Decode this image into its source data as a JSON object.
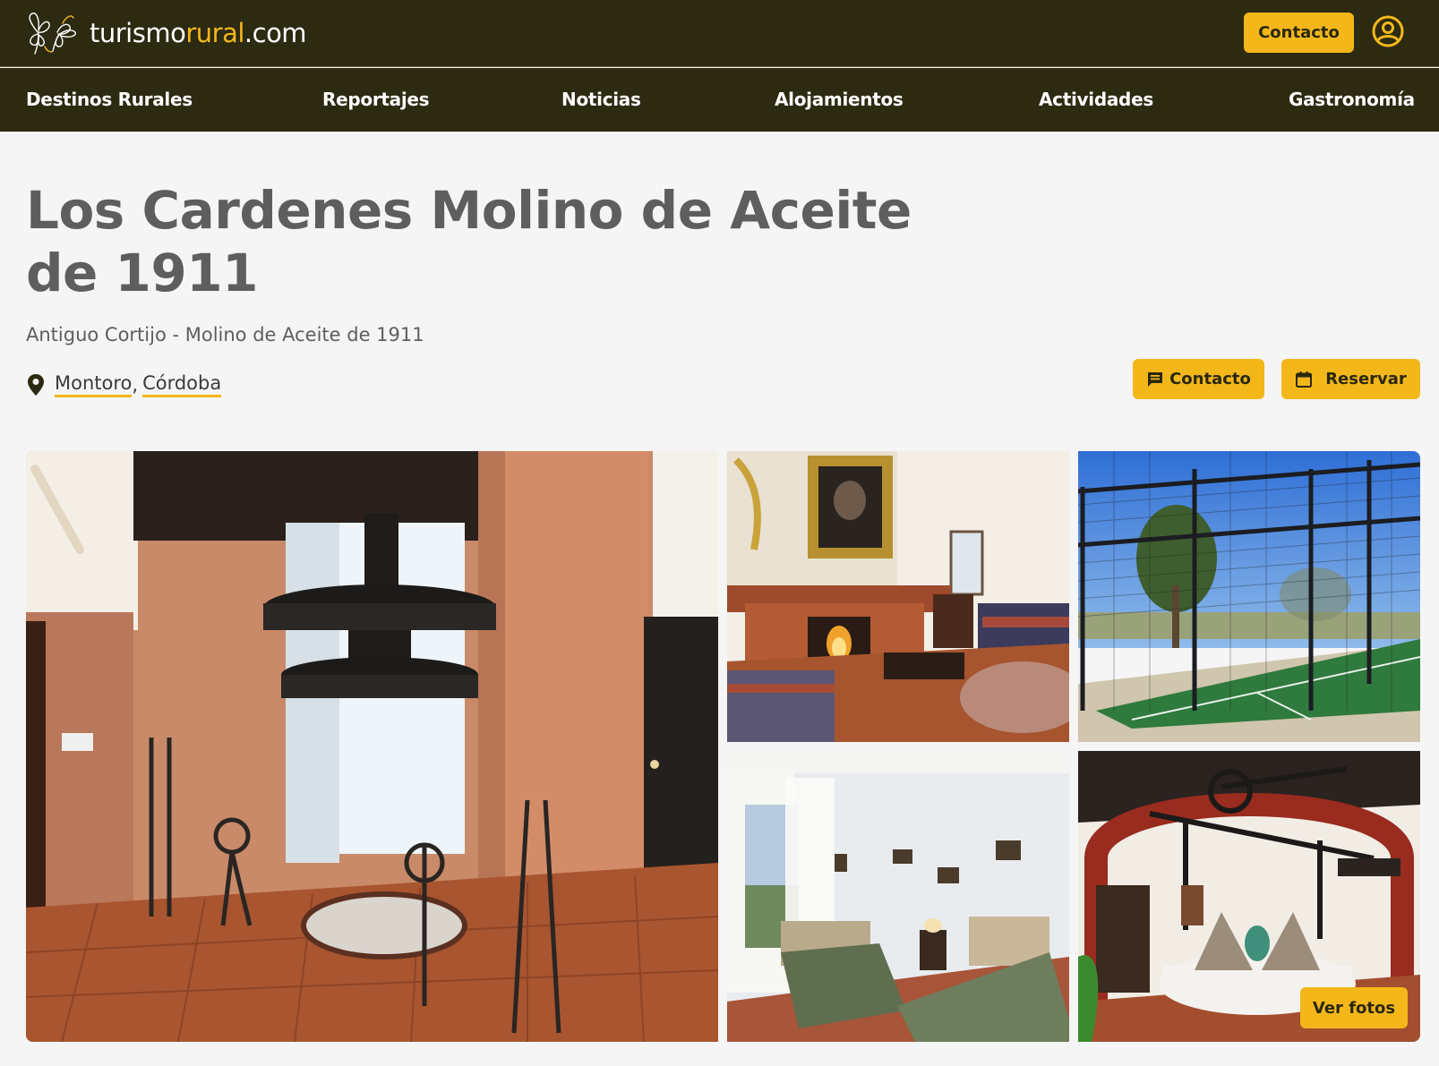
{
  "header": {
    "logo": {
      "text_main": "turismo",
      "text_accent": "rural",
      "text_suffix": ".com",
      "icon": "butterfly-logo-icon"
    },
    "contact_label": "Contacto",
    "user_icon": "user-circle-icon"
  },
  "nav": {
    "items": [
      {
        "label": "Destinos Rurales"
      },
      {
        "label": "Reportajes"
      },
      {
        "label": "Noticias"
      },
      {
        "label": "Alojamientos"
      },
      {
        "label": "Actividades"
      },
      {
        "label": "Gastronomía"
      }
    ]
  },
  "listing": {
    "title": "Los Cardenes Molino de Aceite de 1911",
    "subtitle": "Antiguo Cortijo - Molino de Aceite de 1911",
    "location": {
      "icon": "map-pin-icon",
      "town": "Montoro",
      "separator": ",",
      "province": "Córdoba"
    },
    "actions": {
      "contact_label": "Contacto",
      "contact_icon": "chat-icon",
      "reserve_label": "Reservar",
      "reserve_icon": "calendar-icon"
    }
  },
  "gallery": {
    "see_photos_label": "Ver fotos",
    "photos": [
      {
        "subject": "olive-press-machinery"
      },
      {
        "subject": "living-room-fireplace"
      },
      {
        "subject": "padel-court"
      },
      {
        "subject": "twin-bedroom"
      },
      {
        "subject": "mill-hall-millstones"
      }
    ]
  },
  "colors": {
    "header_bg": "#2d2a12",
    "accent": "#f4b71a",
    "page_bg": "#f5f5f5",
    "title_text": "#5e5e5e"
  }
}
